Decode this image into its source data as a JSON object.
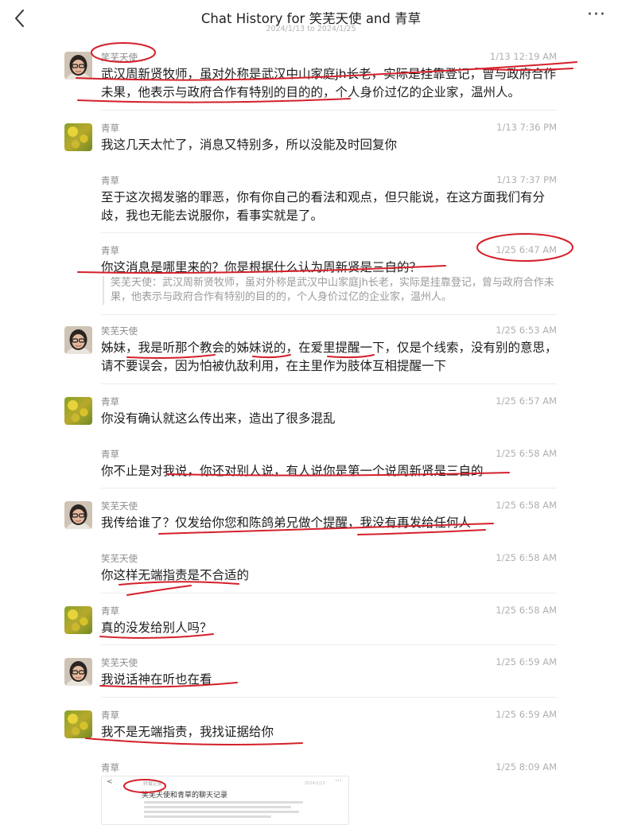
{
  "header": {
    "title": "Chat History for 笑芜天使 and 青草",
    "date_range": "2024/1/13 to 2024/1/25",
    "back_icon": "chevron-left-icon",
    "more_icon": "more-icon"
  },
  "messages": [
    {
      "sender": "笑芜天使",
      "time": "1/13 12:19 AM",
      "avatar": "person-avatar",
      "text": "武汉周新贤牧师，虽对外称是武汉中山家庭jh长老，实际是挂靠登记，曾与政府合作未果，他表示与政府合作有特别的目的的，个人身价过亿的企业家，温州人。"
    },
    {
      "sender": "青草",
      "time": "1/13 7:36 PM",
      "avatar": "flower-avatar",
      "text": "我这几天太忙了，消息又特别多，所以没能及时回复你"
    },
    {
      "sender": "青草",
      "time": "1/13 7:37 PM",
      "avatar": "",
      "text": "至于这次揭发骆的罪恶，你有你自己的看法和观点，但只能说，在这方面我们有分歧，我也无能去说服你，看事实就是了。"
    },
    {
      "sender": "青草",
      "time": "1/25 6:47 AM",
      "avatar": "",
      "text": "你这消息是哪里来的？你是根据什么认为周新贤是三自的？",
      "quote": "笑芜天使：武汉周新贤牧师，虽对外称是武汉中山家庭jh长老，实际是挂靠登记，曾与政府合作未果，他表示与政府合作有特别的目的的，个人身价过亿的企业家，温州人。"
    },
    {
      "sender": "笑芜天使",
      "time": "1/25 6:53 AM",
      "avatar": "person-avatar",
      "text": "姊妹，我是听那个教会的姊妹说的，在爱里提醒一下，仅是个线索，没有别的意思，请不要误会，因为怕被仇敌利用，在主里作为肢体互相提醒一下"
    },
    {
      "sender": "青草",
      "time": "1/25 6:57 AM",
      "avatar": "flower-avatar",
      "text": "你没有确认就这么传出来，造出了很多混乱"
    },
    {
      "sender": "青草",
      "time": "1/25 6:58 AM",
      "avatar": "",
      "text": "你不止是对我说，你还对别人说，有人说你是第一个说周新贤是三自的"
    },
    {
      "sender": "笑芜天使",
      "time": "1/25 6:58 AM",
      "avatar": "person-avatar",
      "text": "我传给谁了？仅发给你您和陈鸽弟兄做个提醒，我没有再发给任何人"
    },
    {
      "sender": "笑芜天使",
      "time": "1/25 6:58 AM",
      "avatar": "",
      "text": "你这样无端指责是不合适的"
    },
    {
      "sender": "青草",
      "time": "1/25 6:58 AM",
      "avatar": "flower-avatar",
      "text": "真的没发给别人吗？"
    },
    {
      "sender": "笑芜天使",
      "time": "1/25 6:59 AM",
      "avatar": "person-avatar",
      "text": "我说话神在听也在看"
    },
    {
      "sender": "青草",
      "time": "1/25 6:59 AM",
      "avatar": "flower-avatar",
      "text": "我不是无端指责，我找证据给你"
    },
    {
      "sender": "青草",
      "time": "1/25 8:09 AM",
      "avatar": "",
      "text": ""
    }
  ],
  "attachment": {
    "title": "笑芜天使和青草的聊天记录",
    "tag": "转载记录",
    "back_glyph": "<",
    "more_glyph": "···",
    "date": "2024/1/13"
  },
  "colors": {
    "annotation": "#d4202a",
    "time": "#b0b0b0",
    "name": "#8a8a8a"
  }
}
